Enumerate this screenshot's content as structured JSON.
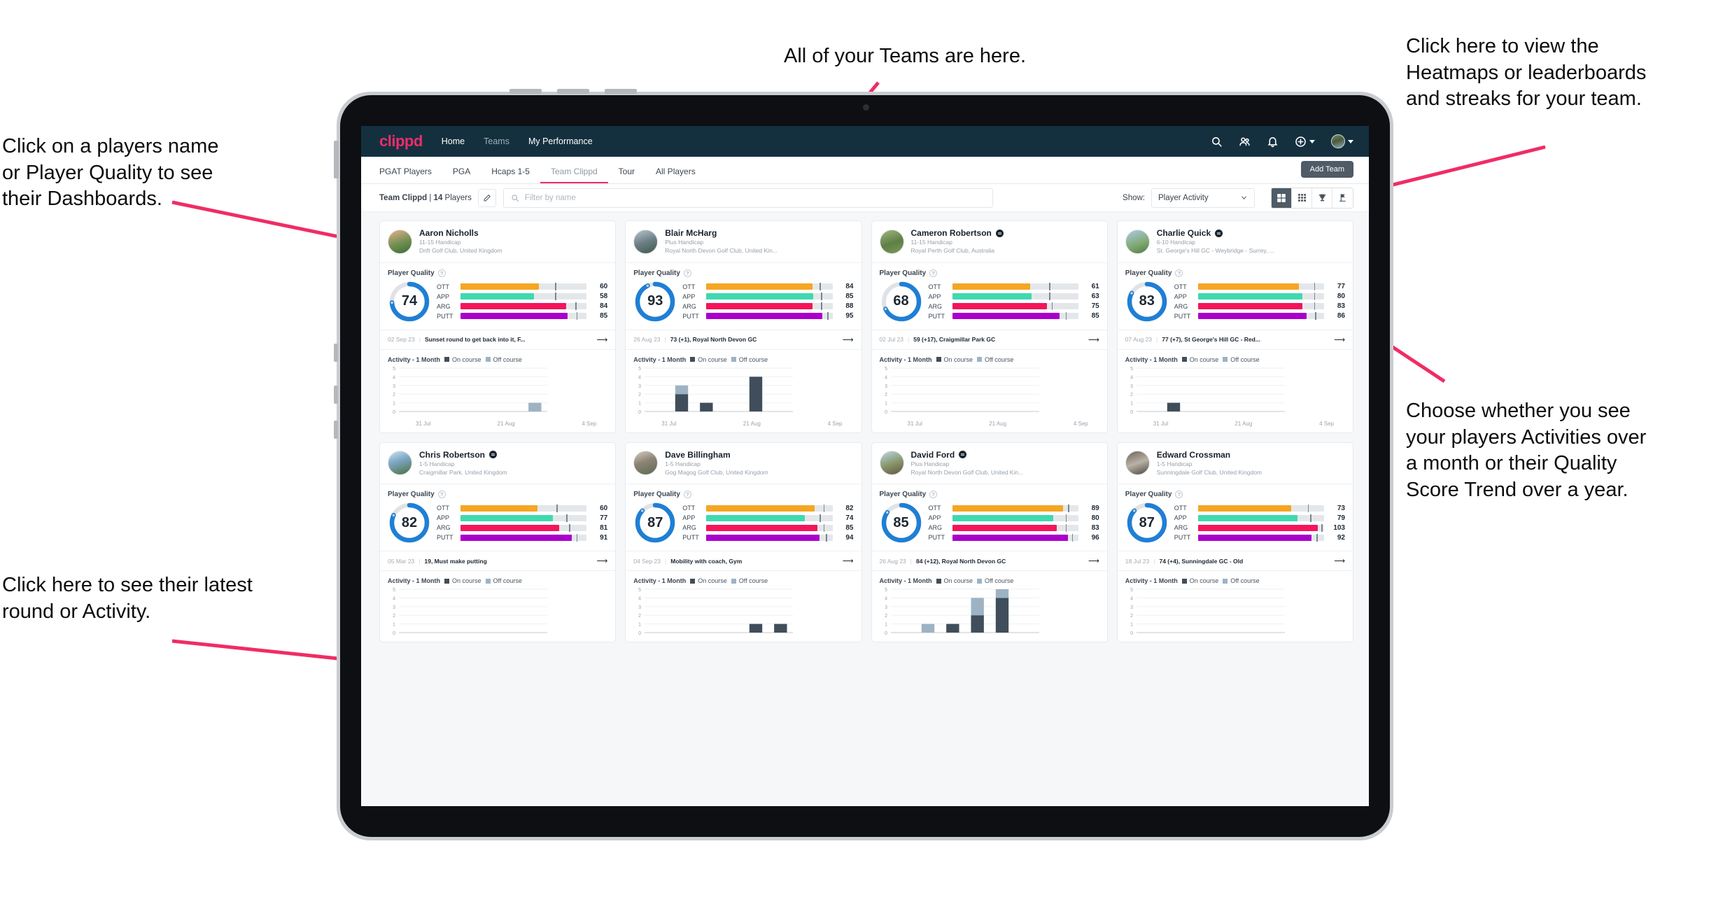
{
  "annotations": [
    {
      "id": "teams",
      "text": "All of your Teams are here."
    },
    {
      "id": "heatmaps",
      "text": "Click here to view the\nHeatmaps or leaderboards\nand streaks for your team."
    },
    {
      "id": "playername",
      "text": "Click on a players name\nor Player Quality to see\ntheir Dashboards."
    },
    {
      "id": "activity-choice",
      "text": "Choose whether you see\nyour players Activities over\na month or their Quality\nScore Trend over a year."
    },
    {
      "id": "latest-round",
      "text": "Click here to see their latest\nround or Activity."
    }
  ],
  "topnav": {
    "logo": "clippd",
    "links": [
      {
        "label": "Home",
        "active": true
      },
      {
        "label": "Teams",
        "active": false
      },
      {
        "label": "My Performance",
        "active": true
      }
    ],
    "icons": [
      "search-icon",
      "people-icon",
      "bell-icon",
      "plus-circle-icon",
      "avatar"
    ]
  },
  "tabs": [
    {
      "label": "PGAT Players",
      "active": false
    },
    {
      "label": "PGA",
      "active": false
    },
    {
      "label": "Hcaps 1-5",
      "active": false
    },
    {
      "label": "Team Clippd",
      "active": true
    },
    {
      "label": "Tour",
      "active": false
    },
    {
      "label": "All Players",
      "active": false
    }
  ],
  "add_team_label": "Add Team",
  "filterbar": {
    "team_name": "Team Clippd",
    "team_separator": " | ",
    "team_count": "14",
    "team_count_suffix": " Players",
    "edit_icon": "pencil-icon",
    "search_placeholder": "Filter by name",
    "search_value": "",
    "show_label": "Show:",
    "show_value": "Player Activity",
    "show_options": [
      "Player Activity",
      "Quality Score Trend"
    ],
    "view_buttons": [
      {
        "name": "grid-4-view",
        "active": true
      },
      {
        "name": "grid-9-view",
        "active": false
      },
      {
        "name": "trophy-view",
        "active": false
      },
      {
        "name": "flag-view",
        "active": false
      }
    ]
  },
  "card_labels": {
    "quality_title": "Player Quality",
    "activity_title": "Activity - 1 Month",
    "legend_on": "On course",
    "legend_off": "Off course",
    "metrics": [
      "OTT",
      "APP",
      "ARG",
      "PUTT"
    ]
  },
  "colors": {
    "brand_pink": "#ec2d6c",
    "navy": "#14303f",
    "ott": "#f5a623",
    "app": "#3fd9b0",
    "arg": "#f5145b",
    "putt": "#aa00cc",
    "ring": "#1f7fd4",
    "on_course": "#3f4e5a",
    "off_course": "#9db3c4"
  },
  "chart_data": {
    "type": "bar",
    "title": "Activity - 1 Month",
    "ylabel": "",
    "xlabel": "",
    "ylim": [
      0,
      5
    ],
    "yticks": [
      0,
      1,
      2,
      3,
      4,
      5
    ],
    "categories": [
      "31 Jul",
      "21 Aug",
      "4 Sep"
    ],
    "legend": [
      "On course",
      "Off course"
    ],
    "legend_position": "top",
    "grid": true,
    "per_player": [
      {
        "player": "Aaron Nicholls",
        "bars": [
          {
            "slot": 5,
            "on": 0,
            "off": 1
          }
        ]
      },
      {
        "player": "Blair McHarg",
        "bars": [
          {
            "slot": 1,
            "on": 2,
            "off": 1
          },
          {
            "slot": 2,
            "on": 1,
            "off": 0
          },
          {
            "slot": 4,
            "on": 4,
            "off": 0
          }
        ]
      },
      {
        "player": "Cameron Robertson",
        "bars": []
      },
      {
        "player": "Charlie Quick",
        "bars": [
          {
            "slot": 1,
            "on": 1,
            "off": 0
          }
        ]
      },
      {
        "player": "Chris Robertson",
        "bars": []
      },
      {
        "player": "Dave Billingham",
        "bars": [
          {
            "slot": 4,
            "on": 1,
            "off": 0
          },
          {
            "slot": 5,
            "on": 1,
            "off": 0
          }
        ]
      },
      {
        "player": "David Ford",
        "bars": [
          {
            "slot": 1,
            "on": 0,
            "off": 1
          },
          {
            "slot": 2,
            "on": 1,
            "off": 0
          },
          {
            "slot": 3,
            "on": 2,
            "off": 2
          },
          {
            "slot": 4,
            "on": 4,
            "off": 1
          }
        ]
      },
      {
        "player": "Edward Crossman",
        "bars": []
      }
    ]
  },
  "players": [
    {
      "name": "Aaron Nicholls",
      "verified": false,
      "handicap": "11-15 Handicap",
      "club": "Drift Golf Club, United Kingdom",
      "score": 74,
      "metrics": [
        {
          "label": "OTT",
          "value": 60,
          "fill": 62,
          "tick": 75
        },
        {
          "label": "APP",
          "value": 58,
          "fill": 58,
          "tick": 75
        },
        {
          "label": "ARG",
          "value": 84,
          "fill": 84,
          "tick": 91
        },
        {
          "label": "PUTT",
          "value": 85,
          "fill": 85,
          "tick": 92
        }
      ],
      "round_date": "02 Sep 23",
      "round_text": "Sunset round to get back into it, F...",
      "bars": [
        {
          "slot": 5,
          "on": 0,
          "off": 1
        }
      ]
    },
    {
      "name": "Blair McHarg",
      "verified": false,
      "handicap": "Plus Handicap",
      "club": "Royal North Devon Golf Club, United Kin...",
      "score": 93,
      "metrics": [
        {
          "label": "OTT",
          "value": 84,
          "fill": 84,
          "tick": 90
        },
        {
          "label": "APP",
          "value": 85,
          "fill": 85,
          "tick": 91
        },
        {
          "label": "ARG",
          "value": 88,
          "fill": 84,
          "tick": 91
        },
        {
          "label": "PUTT",
          "value": 95,
          "fill": 92,
          "tick": 96
        }
      ],
      "round_date": "26 Aug 23",
      "round_text": "73 (+1), Royal North Devon GC",
      "bars": [
        {
          "slot": 1,
          "on": 2,
          "off": 1
        },
        {
          "slot": 2,
          "on": 1,
          "off": 0
        },
        {
          "slot": 4,
          "on": 4,
          "off": 0
        }
      ]
    },
    {
      "name": "Cameron Robertson",
      "verified": true,
      "handicap": "11-15 Handicap",
      "club": "Royal Perth Golf Club, Australia",
      "score": 68,
      "metrics": [
        {
          "label": "OTT",
          "value": 61,
          "fill": 62,
          "tick": 77
        },
        {
          "label": "APP",
          "value": 63,
          "fill": 63,
          "tick": 77
        },
        {
          "label": "ARG",
          "value": 75,
          "fill": 75,
          "tick": 79
        },
        {
          "label": "PUTT",
          "value": 85,
          "fill": 85,
          "tick": 90
        }
      ],
      "round_date": "02 Jul 23",
      "round_text": "59 (+17), Craigmillar Park GC",
      "bars": []
    },
    {
      "name": "Charlie Quick",
      "verified": true,
      "handicap": "6-10 Handicap",
      "club": "St. George's Hill GC - Weybridge - Surrey, ...",
      "score": 83,
      "metrics": [
        {
          "label": "OTT",
          "value": 77,
          "fill": 80,
          "tick": 92
        },
        {
          "label": "APP",
          "value": 80,
          "fill": 83,
          "tick": 92
        },
        {
          "label": "ARG",
          "value": 83,
          "fill": 83,
          "tick": 92
        },
        {
          "label": "PUTT",
          "value": 86,
          "fill": 86,
          "tick": 93
        }
      ],
      "round_date": "07 Aug 23",
      "round_text": "77 (+7), St George's Hill GC - Red...",
      "bars": [
        {
          "slot": 1,
          "on": 1,
          "off": 0
        }
      ]
    },
    {
      "name": "Chris Robertson",
      "verified": true,
      "handicap": "1-5 Handicap",
      "club": "Craigmillar Park, United Kingdom",
      "score": 82,
      "metrics": [
        {
          "label": "OTT",
          "value": 60,
          "fill": 61,
          "tick": 76
        },
        {
          "label": "APP",
          "value": 77,
          "fill": 73,
          "tick": 84
        },
        {
          "label": "ARG",
          "value": 81,
          "fill": 78,
          "tick": 86
        },
        {
          "label": "PUTT",
          "value": 91,
          "fill": 88,
          "tick": 92
        }
      ],
      "round_date": "05 Mar 23",
      "round_text": "19, Must make putting",
      "bars": []
    },
    {
      "name": "Dave Billingham",
      "verified": false,
      "handicap": "1-5 Handicap",
      "club": "Gog Magog Golf Club, United Kingdom",
      "score": 87,
      "metrics": [
        {
          "label": "OTT",
          "value": 82,
          "fill": 86,
          "tick": 93
        },
        {
          "label": "APP",
          "value": 74,
          "fill": 78,
          "tick": 90
        },
        {
          "label": "ARG",
          "value": 85,
          "fill": 88,
          "tick": 93
        },
        {
          "label": "PUTT",
          "value": 94,
          "fill": 90,
          "tick": 95
        }
      ],
      "round_date": "04 Sep 23",
      "round_text": "Mobility with coach, Gym",
      "bars": [
        {
          "slot": 4,
          "on": 1,
          "off": 0
        },
        {
          "slot": 5,
          "on": 1,
          "off": 0
        }
      ]
    },
    {
      "name": "David Ford",
      "verified": true,
      "handicap": "Plus Handicap",
      "club": "Royal North Devon Golf Club, United Kin...",
      "score": 85,
      "metrics": [
        {
          "label": "OTT",
          "value": 89,
          "fill": 88,
          "tick": 92
        },
        {
          "label": "APP",
          "value": 80,
          "fill": 80,
          "tick": 90
        },
        {
          "label": "ARG",
          "value": 83,
          "fill": 83,
          "tick": 90
        },
        {
          "label": "PUTT",
          "value": 96,
          "fill": 92,
          "tick": 95
        }
      ],
      "round_date": "26 Aug 23",
      "round_text": "84 (+12), Royal North Devon GC",
      "bars": [
        {
          "slot": 1,
          "on": 0,
          "off": 1
        },
        {
          "slot": 2,
          "on": 1,
          "off": 0
        },
        {
          "slot": 3,
          "on": 2,
          "off": 2
        },
        {
          "slot": 4,
          "on": 4,
          "off": 1
        }
      ]
    },
    {
      "name": "Edward Crossman",
      "verified": false,
      "handicap": "1-5 Handicap",
      "club": "Sunningdale Golf Club, United Kingdom",
      "score": 87,
      "metrics": [
        {
          "label": "OTT",
          "value": 73,
          "fill": 74,
          "tick": 87
        },
        {
          "label": "APP",
          "value": 79,
          "fill": 79,
          "tick": 89
        },
        {
          "label": "ARG",
          "value": 103,
          "fill": 95,
          "tick": 98
        },
        {
          "label": "PUTT",
          "value": 92,
          "fill": 90,
          "tick": 94
        }
      ],
      "round_date": "18 Jul 23",
      "round_text": "74 (+4), Sunningdale GC - Old",
      "bars": []
    }
  ]
}
